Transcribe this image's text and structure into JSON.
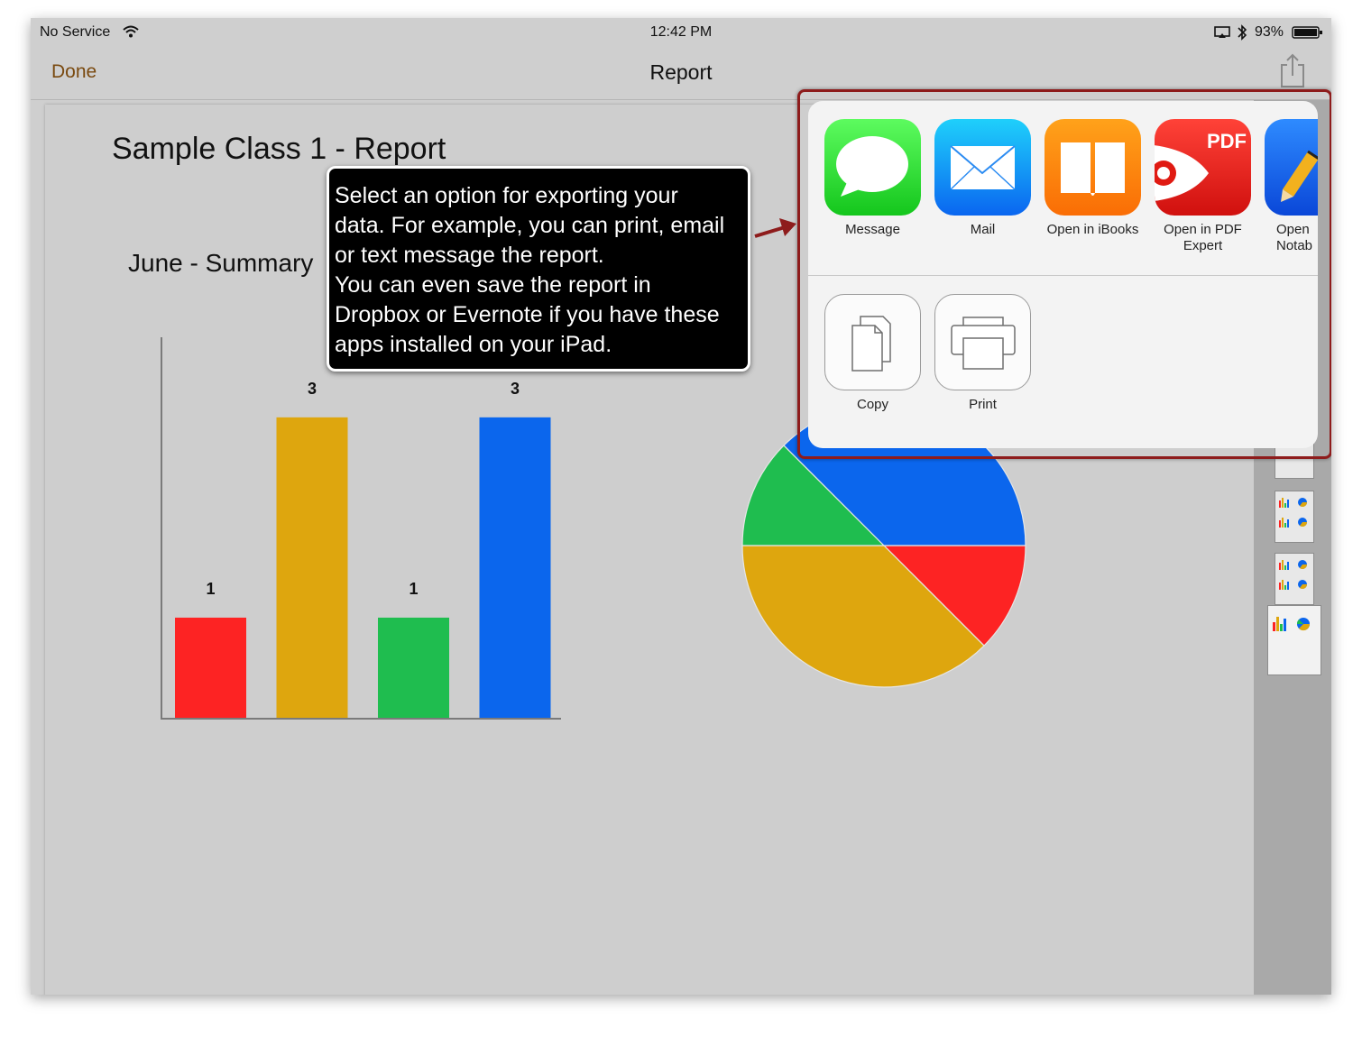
{
  "statusbar": {
    "carrier": "No Service",
    "time": "12:42 PM",
    "battery": "93%"
  },
  "navbar": {
    "done_label": "Done",
    "title": "Report",
    "share_icon": "share-icon"
  },
  "report": {
    "title": "Sample Class 1 - Report",
    "subtitle": "June - Summary"
  },
  "callout": {
    "lines": [
      "Select an option for exporting your",
      "data. For example, you can print, email",
      "or text message the report.",
      "You can even save the report in",
      "Dropbox or Evernote if you have these",
      "apps installed on your iPad."
    ]
  },
  "share_sheet": {
    "apps": [
      {
        "label": "Message",
        "icon": "message-icon"
      },
      {
        "label": "Mail",
        "icon": "mail-icon"
      },
      {
        "label": "Open in iBooks",
        "icon": "ibooks-icon"
      },
      {
        "label": "Open in PDF\nExpert",
        "icon": "pdf-expert-icon",
        "badge": "PDF"
      },
      {
        "label": "Open\nNotab",
        "icon": "notability-icon"
      }
    ],
    "actions": [
      {
        "label": "Copy",
        "icon": "copy-icon"
      },
      {
        "label": "Print",
        "icon": "print-icon"
      }
    ]
  },
  "colors": {
    "red": "#fd2323",
    "yellow": "#dea60e",
    "green": "#1fbd4f",
    "blue": "#0b66ed",
    "highlight": "#8e1c1c",
    "done": "#7a4a10"
  },
  "chart_data": [
    {
      "type": "bar",
      "categories": [
        "",
        "",
        "",
        ""
      ],
      "values": [
        1,
        3,
        1,
        3
      ],
      "colors": [
        "#fd2323",
        "#dea60e",
        "#1fbd4f",
        "#0b66ed"
      ],
      "ylim": [
        0,
        3.8
      ]
    },
    {
      "type": "pie",
      "values": [
        1,
        3,
        1,
        3
      ],
      "colors": [
        "#fd2323",
        "#dea60e",
        "#1fbd4f",
        "#0b66ed"
      ]
    }
  ]
}
